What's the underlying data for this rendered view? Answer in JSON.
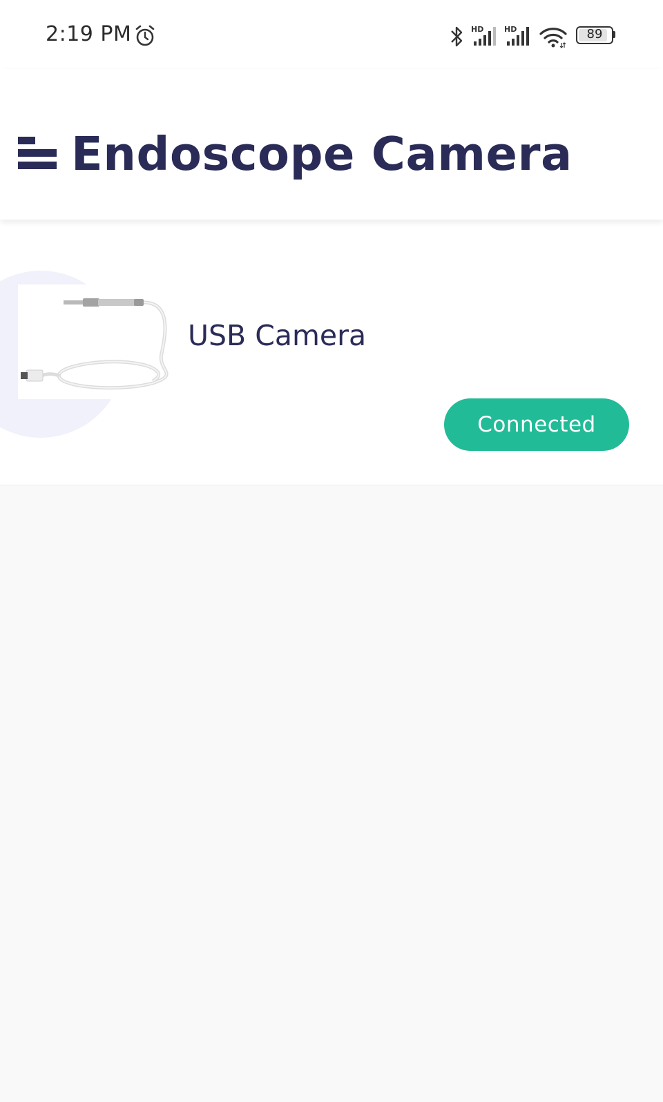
{
  "status_bar": {
    "time": "2:19 PM",
    "battery_level": "89",
    "icons": [
      "alarm-icon",
      "bluetooth-icon",
      "hd-signal-icon",
      "hd-signal-icon",
      "wifi-icon",
      "battery-icon"
    ]
  },
  "app_bar": {
    "title": "Endoscope Camera",
    "menu_icon": "menu-icon"
  },
  "device": {
    "name": "USB Camera",
    "status_label": "Connected",
    "status_color": "#22bb97"
  },
  "colors": {
    "primary_text": "#2a2b57",
    "accent": "#22bb97",
    "background": "#f9f9f9"
  }
}
